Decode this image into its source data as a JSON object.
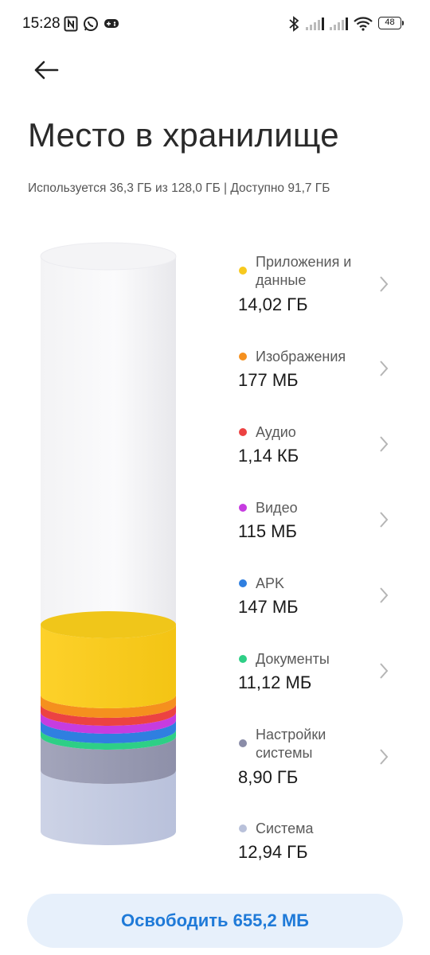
{
  "status_bar": {
    "time": "15:28",
    "battery": "48",
    "icons": [
      "nfc-icon",
      "whatsapp-icon",
      "game-controller-icon",
      "bluetooth-icon",
      "signal-icon",
      "signal-icon",
      "wifi-icon",
      "battery-icon"
    ]
  },
  "header": {
    "back_icon": "arrow-left-icon",
    "title": "Место в хранилище",
    "summary": "Используется 36,3 ГБ из 128,0 ГБ | Доступно 91,7 ГБ"
  },
  "categories": [
    {
      "label": "Приложения и данные",
      "size": "14,02 ГБ",
      "color": "#F7C91E"
    },
    {
      "label": "Изображения",
      "size": "177 МБ",
      "color": "#F5901E"
    },
    {
      "label": "Аудио",
      "size": "1,14 КБ",
      "color": "#EC4242"
    },
    {
      "label": "Видео",
      "size": "115 МБ",
      "color": "#C63CE0"
    },
    {
      "label": "APK",
      "size": "147 МБ",
      "color": "#2F7FE0"
    },
    {
      "label": "Документы",
      "size": "11,12 МБ",
      "color": "#2ECF86"
    },
    {
      "label": "Настройки системы",
      "size": "8,90 ГБ",
      "color": "#8A8CA8"
    },
    {
      "label": "Система",
      "size": "12,94 ГБ",
      "color": "#B9C1DA"
    }
  ],
  "free_button": {
    "label": "Освободить 655,2 МБ"
  }
}
